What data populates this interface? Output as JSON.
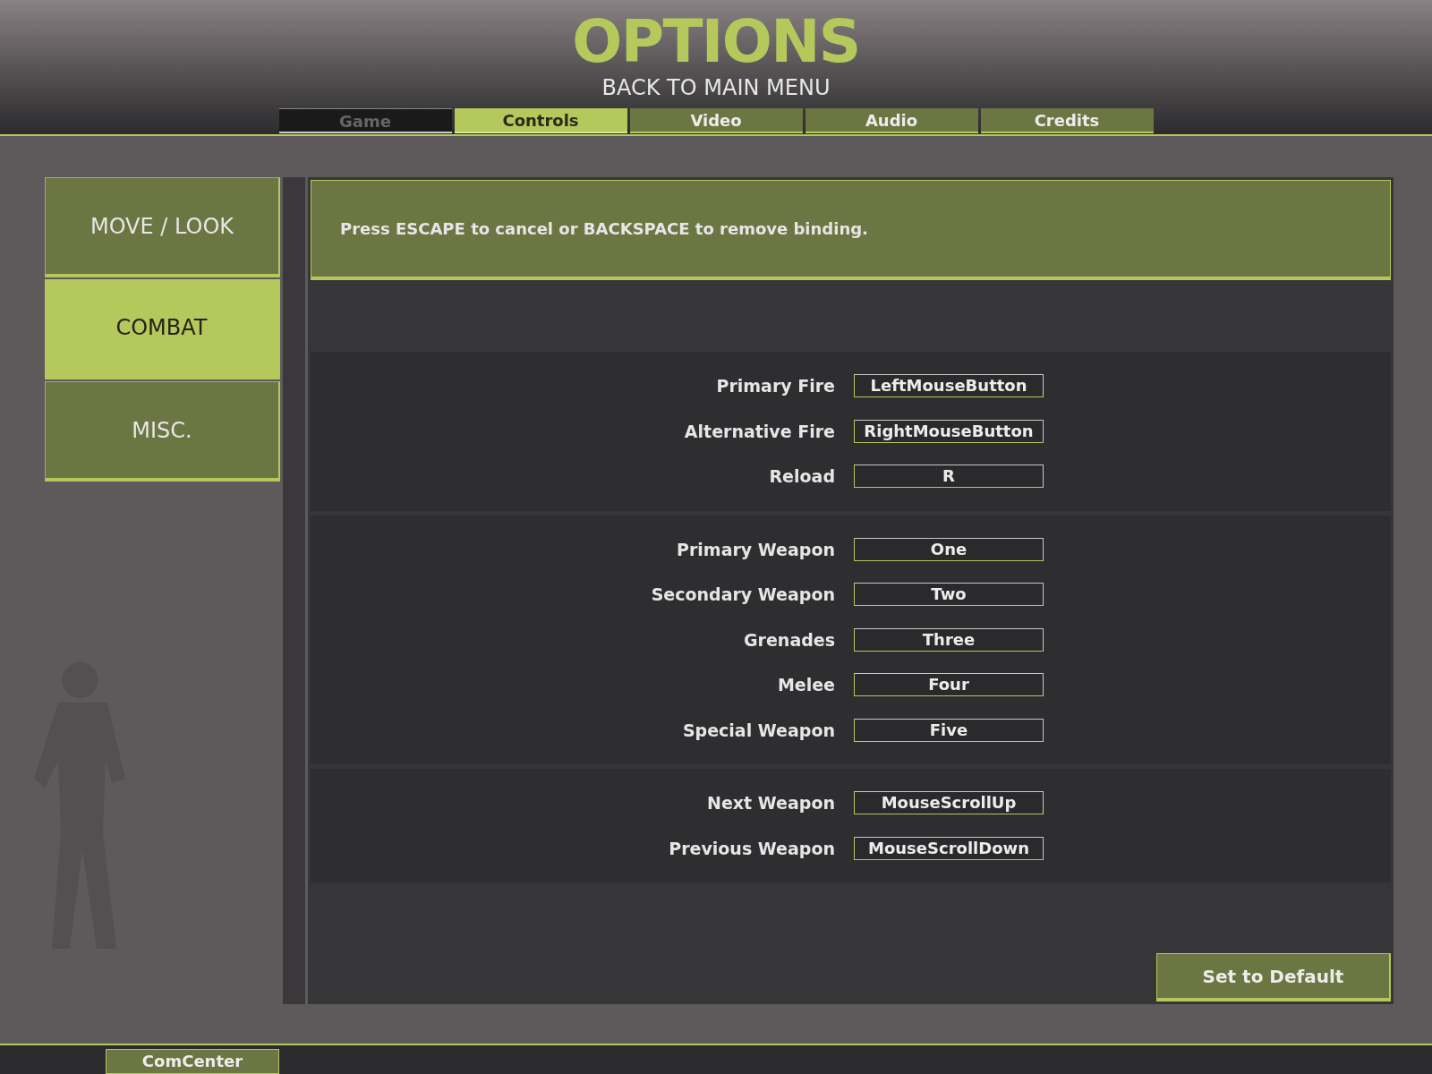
{
  "title": "OPTIONS",
  "back_link": "BACK TO MAIN MENU",
  "tabs": [
    {
      "label": "Game",
      "selected": false,
      "disabled": true
    },
    {
      "label": "Controls",
      "selected": true,
      "disabled": false
    },
    {
      "label": "Video",
      "selected": false,
      "disabled": false
    },
    {
      "label": "Audio",
      "selected": false,
      "disabled": false
    },
    {
      "label": "Credits",
      "selected": false,
      "disabled": false
    }
  ],
  "sidebar": {
    "items": [
      {
        "label": "MOVE / LOOK",
        "selected": false
      },
      {
        "label": "COMBAT",
        "selected": true
      },
      {
        "label": "MISC.",
        "selected": false
      }
    ]
  },
  "info": "Press ESCAPE to cancel or BACKSPACE to remove binding.",
  "groups": [
    {
      "bindings": [
        {
          "action": "Primary Fire",
          "key": "LeftMouseButton"
        },
        {
          "action": "Alternative Fire",
          "key": "RightMouseButton"
        },
        {
          "action": "Reload",
          "key": "R"
        }
      ]
    },
    {
      "bindings": [
        {
          "action": "Primary Weapon",
          "key": "One"
        },
        {
          "action": "Secondary Weapon",
          "key": "Two"
        },
        {
          "action": "Grenades",
          "key": "Three"
        },
        {
          "action": "Melee",
          "key": "Four"
        },
        {
          "action": "Special Weapon",
          "key": "Five"
        }
      ]
    },
    {
      "bindings": [
        {
          "action": "Next Weapon",
          "key": "MouseScrollUp"
        },
        {
          "action": "Previous Weapon",
          "key": "MouseScrollDown"
        }
      ]
    }
  ],
  "default_button": "Set to Default",
  "bottom_bar": {
    "button": "ComCenter"
  }
}
